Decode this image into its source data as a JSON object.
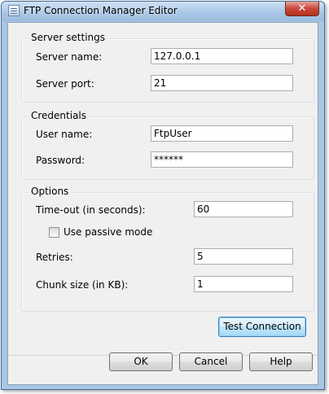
{
  "window": {
    "title": "FTP Connection Manager Editor",
    "close_glyph": "✕"
  },
  "server_settings": {
    "group_label": "Server settings",
    "server_name_label": "Server name:",
    "server_name_value": "127.0.0.1",
    "server_port_label": "Server port:",
    "server_port_value": "21"
  },
  "credentials": {
    "group_label": "Credentials",
    "user_name_label": "User name:",
    "user_name_value": "FtpUser",
    "password_label": "Password:",
    "password_value": "******"
  },
  "options": {
    "group_label": "Options",
    "timeout_label": "Time-out (in seconds):",
    "timeout_value": "60",
    "passive_mode_label": "Use passive mode",
    "passive_mode_checked": false,
    "retries_label": "Retries:",
    "retries_value": "5",
    "chunk_size_label": "Chunk size (in KB):",
    "chunk_size_value": "1"
  },
  "buttons": {
    "test_connection": "Test Connection",
    "ok": "OK",
    "cancel": "Cancel",
    "help": "Help"
  },
  "colors": {
    "window_frame": "#a9c6e4",
    "dialog_background": "#f0f0f0",
    "close_button": "#c7493a",
    "focus_border": "#3c7fb1"
  },
  "icons": {
    "app": "window-app-icon",
    "close": "close-icon"
  }
}
